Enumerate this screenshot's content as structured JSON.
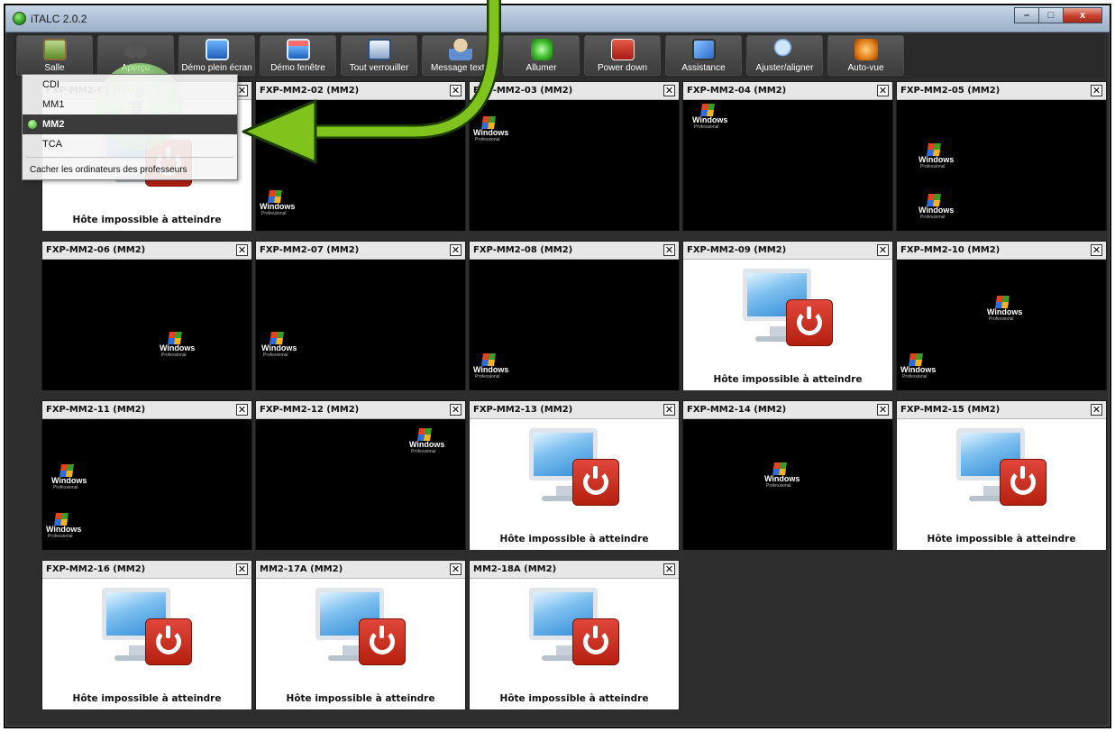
{
  "window": {
    "title": "iTALC 2.0.2",
    "minimize": "–",
    "maximize": "□",
    "close": "x"
  },
  "toolbar": [
    {
      "label": "Salle",
      "icon": "classroom-icon"
    },
    {
      "label": "Aperçu",
      "icon": "binoculars-icon"
    },
    {
      "label": "Démo plein écran",
      "icon": "fullscreen-demo-icon"
    },
    {
      "label": "Démo fenêtre",
      "icon": "window-demo-icon"
    },
    {
      "label": "Tout verrouiller",
      "icon": "lock-all-icon"
    },
    {
      "label": "Message texte",
      "icon": "text-message-icon"
    },
    {
      "label": "Allumer",
      "icon": "power-on-icon"
    },
    {
      "label": "Power down",
      "icon": "power-down-icon"
    },
    {
      "label": "Assistance",
      "icon": "assistance-icon"
    },
    {
      "label": "Ajuster/aligner",
      "icon": "align-zoom-icon"
    },
    {
      "label": "Auto-vue",
      "icon": "auto-view-icon"
    }
  ],
  "menu": {
    "items": [
      {
        "label": "CDI",
        "selected": false
      },
      {
        "label": "MM1",
        "selected": false
      },
      {
        "label": "MM2",
        "selected": true
      },
      {
        "label": "TCA",
        "selected": false
      }
    ],
    "hide_teachers": "Cacher les ordinateurs des professeurs"
  },
  "tiles": [
    {
      "name": "FXP-MM2-01 (MM2)",
      "state": "off"
    },
    {
      "name": "FXP-MM2-02 (MM2)",
      "state": "screen"
    },
    {
      "name": "FXP-MM2-03 (MM2)",
      "state": "screen"
    },
    {
      "name": "FXP-MM2-04 (MM2)",
      "state": "screen"
    },
    {
      "name": "FXP-MM2-05 (MM2)",
      "state": "screen"
    },
    {
      "name": "FXP-MM2-06 (MM2)",
      "state": "screen"
    },
    {
      "name": "FXP-MM2-07 (MM2)",
      "state": "screen"
    },
    {
      "name": "FXP-MM2-08 (MM2)",
      "state": "screen"
    },
    {
      "name": "FXP-MM2-09 (MM2)",
      "state": "off"
    },
    {
      "name": "FXP-MM2-10 (MM2)",
      "state": "screen"
    },
    {
      "name": "FXP-MM2-11 (MM2)",
      "state": "screen"
    },
    {
      "name": "FXP-MM2-12 (MM2)",
      "state": "screen"
    },
    {
      "name": "FXP-MM2-13 (MM2)",
      "state": "off"
    },
    {
      "name": "FXP-MM2-14 (MM2)",
      "state": "screen"
    },
    {
      "name": "FXP-MM2-15 (MM2)",
      "state": "off"
    },
    {
      "name": "FXP-MM2-16 (MM2)",
      "state": "off"
    },
    {
      "name": "MM2-17A (MM2)",
      "state": "off"
    },
    {
      "name": "MM2-18A (MM2)",
      "state": "off"
    }
  ],
  "unreachable_text": "Hôte impossible à atteindre",
  "tile_close": "✕",
  "windows_logo": {
    "brand": "Windows",
    "edition": "Professional"
  },
  "colors": {
    "annotation_arrow": "#7fc31c",
    "menu_active": "#3b3b3b"
  }
}
